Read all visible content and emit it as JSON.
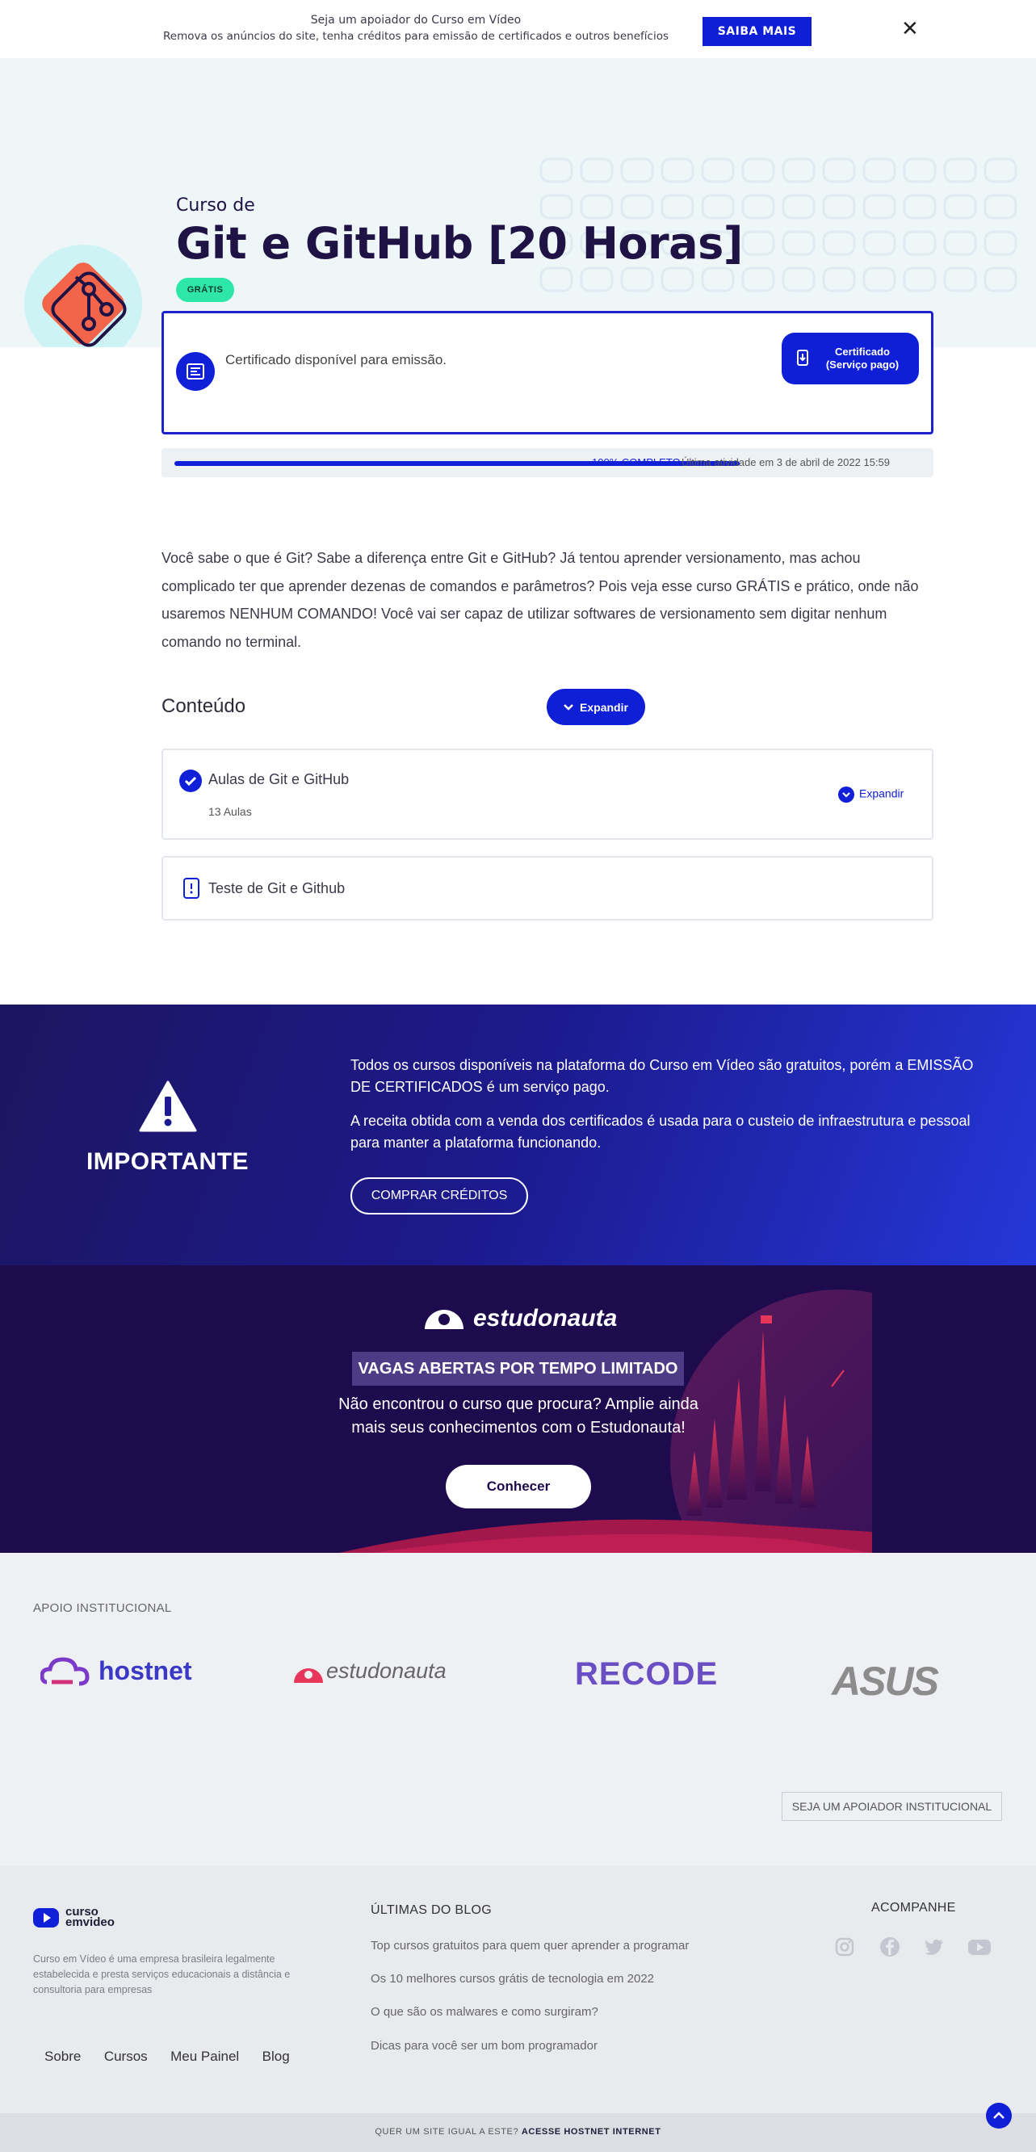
{
  "banner": {
    "line1": "Seja um apoiador do Curso em Vídeo",
    "line2": "Remova os anúncios do site, tenha créditos para emissão de certificados e outros benefícios",
    "cta": "SAIBA MAIS",
    "close": "✕"
  },
  "course": {
    "pre": "Curso de",
    "title": "Git e GitHub [20 Horas]",
    "badge": "GRÁTIS"
  },
  "certificate": {
    "text": "Certificado disponível para emissão.",
    "button_line1": "Certificado",
    "button_line2": "(Serviço pago)"
  },
  "progress": {
    "percent": 100,
    "label": "100% COMPLETO",
    "last_activity": "Última atividade em 3 de abril de 2022 15:59"
  },
  "description": "Você sabe o que é Git? Sabe a diferença entre Git e GitHub? Já tentou aprender versionamento, mas achou complicado ter que aprender dezenas de comandos e parâmetros? Pois veja esse curso GRÁTIS e prático, onde não usaremos NENHUM COMANDO! Você vai ser capaz de utilizar softwares de versionamento sem digitar nenhum comando no terminal.",
  "content": {
    "title": "Conteúdo",
    "expand_label": "Expandir",
    "modules": [
      {
        "title": "Aulas de Git e GitHub",
        "subtitle": "13 Aulas",
        "expand": "Expandir"
      },
      {
        "title": "Teste de Git e Github"
      }
    ]
  },
  "important": {
    "title": "IMPORTANTE",
    "p1": "Todos os cursos disponíveis na plataforma do Curso em Vídeo são gratuitos, porém a EMISSÃO DE CERTIFICADOS é um serviço pago.",
    "p2": "A receita obtida com a venda dos certificados é usada para o custeio de infraestrutura e pessoal para manter a plataforma funcionando.",
    "button": "COMPRAR CRÉDITOS"
  },
  "estudonauta": {
    "logo": "estudonauta",
    "tag": "VAGAS ABERTAS POR TEMPO LIMITADO",
    "text": "Não encontrou o curso que procura? Amplie ainda mais seus conhecimentos com o Estudonauta!",
    "button": "Conhecer"
  },
  "apoio": {
    "title": "APOIO INSTITUCIONAL",
    "logos": [
      "hostnet",
      "estudonauta",
      "RECODE",
      "ASUS"
    ],
    "button": "SEJA UM APOIADOR INSTITUCIONAL"
  },
  "footer": {
    "logo_line1": "curso",
    "logo_line2": "emvideo",
    "about": "Curso em Vídeo é uma empresa brasileira legalmente estabelecida e presta serviços educacionais a distância e consultoria para empresas",
    "nav": [
      "Sobre",
      "Cursos",
      "Meu Painel",
      "Blog"
    ],
    "blog_title": "ÚLTIMAS DO BLOG",
    "blog_links": [
      "Top cursos gratuitos para quem quer aprender a programar",
      "Os 10 melhores cursos grátis de tecnologia em 2022",
      "O que são os malwares e como surgiram?",
      "Dicas para você ser um bom programador"
    ],
    "follow_title": "ACOMPANHE",
    "social": [
      "instagram-icon",
      "facebook-icon",
      "twitter-icon",
      "youtube-icon"
    ]
  },
  "bottom": {
    "prefix": "QUER UM SITE IGUAL A ESTE?",
    "link": "ACESSE HOSTNET INTERNET"
  },
  "colors": {
    "primary": "#0f1fd8",
    "navy": "#1f1245",
    "badge": "#2ee6a8"
  }
}
